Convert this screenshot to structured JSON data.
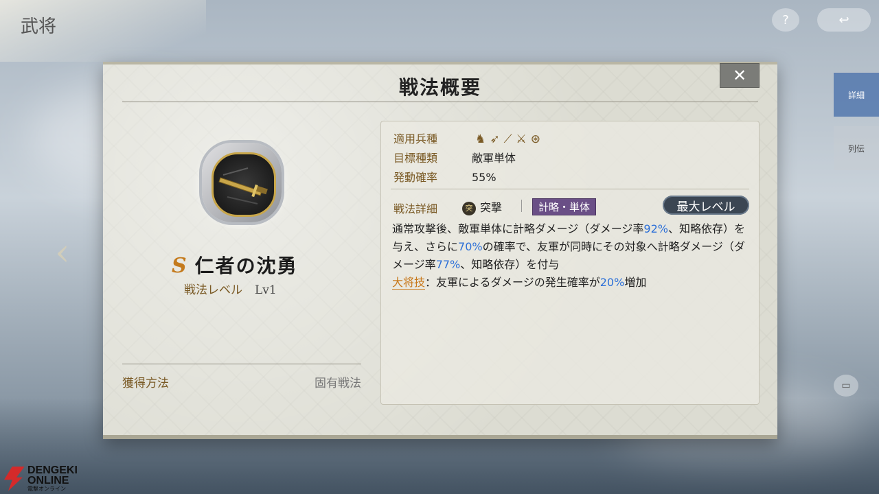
{
  "background": {
    "top_left_text": "武将",
    "help_icon": "?",
    "back_icon": "↩",
    "right_tab_active": "詳細",
    "right_tab_second": "列伝",
    "chat_icon": "chat-icon"
  },
  "dialog": {
    "title": "戦法概要",
    "close_label": "✕"
  },
  "skill": {
    "rank": "S",
    "name": "仁者の沈勇",
    "level_label": "戦法レベル",
    "level_value": "Lv1",
    "acquire_label": "獲得方法",
    "acquire_value": "固有戦法"
  },
  "info": {
    "unit_label": "適用兵種",
    "unit_icons": [
      "cavalry-icon",
      "archer-icon",
      "spear-icon",
      "shield-icon",
      "siege-icon"
    ],
    "target_label": "目標種類",
    "target_value": "敵軍単体",
    "rate_label": "発動確率",
    "rate_value": "55%",
    "detail_label": "戦法詳細",
    "strike_icon": "突",
    "strike_label": "突撃",
    "strategy_tag": "計略・単体",
    "max_level": "最大レベル",
    "desc_1": "通常攻撃後、敵軍単体に計略ダメージ（ダメージ率",
    "desc_n1": "92%",
    "desc_2": "、知略依存）を与え、さらに",
    "desc_n2": "70%",
    "desc_3": "の確率で、友軍が同時にその対象へ計略ダメージ（ダメージ率",
    "desc_n3": "77%",
    "desc_4": "、知略依存）を付与",
    "general_label": "大将技",
    "general_1": "：友軍によるダメージの発生確率が",
    "general_n": "20%",
    "general_2": "増加"
  },
  "watermark": {
    "line1": "DENGEKI",
    "line2": "ONLINE",
    "line3": "電撃オンライン"
  }
}
